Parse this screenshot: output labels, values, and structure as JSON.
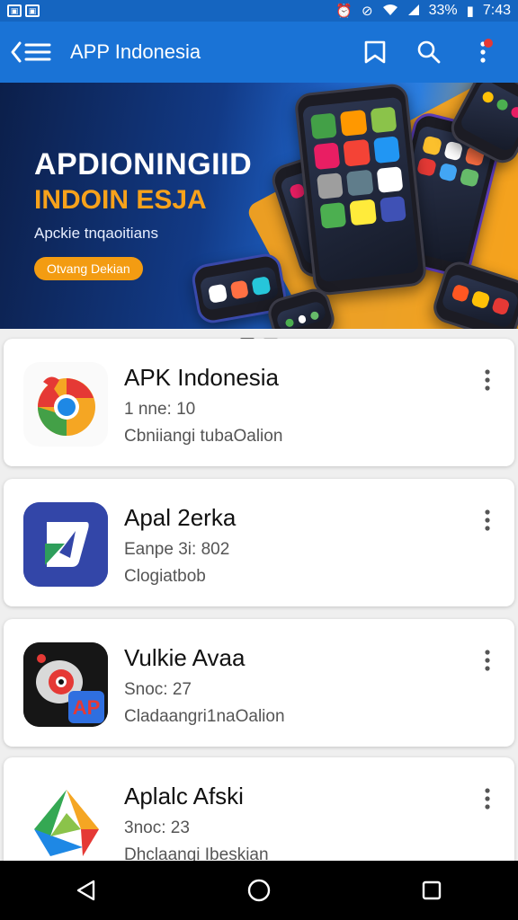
{
  "status_bar": {
    "left_icons": [
      "notification-icon",
      "notification-icon"
    ],
    "right_icons": [
      "alarm-icon",
      "no-sim-icon",
      "wifi-icon",
      "signal-icon"
    ],
    "battery": "33%",
    "time": "7:43"
  },
  "app_bar": {
    "title": "APP Indonesia",
    "icons": [
      "back-menu-icon",
      "bookmark-icon",
      "search-icon",
      "more-vert-icon"
    ]
  },
  "banner": {
    "title": "APDIONINGIID",
    "subtitle": "INDOIN ESJA",
    "tagline": "Apckie tnqaoitians",
    "button_label": "Otvang Dekian"
  },
  "pager": {
    "count": 2,
    "active": 0
  },
  "apps": [
    {
      "name": "APK Indonesia",
      "line1": "1 nne: 10",
      "line2": "Cbniiangi tubaOalion",
      "icon": "chrome-like-icon"
    },
    {
      "name": "Apal  2erka",
      "line1": "Eanpe 3i: 802",
      "line2": "Clogiatbob",
      "icon": "play-arrow-icon"
    },
    {
      "name": "Vulkie Avaa",
      "line1": "Snoc: 27",
      "line2": "Cladaangri1naOalion",
      "icon": "ap-mascot-icon",
      "icon_badge": "AP"
    },
    {
      "name": "Aplalc Afski",
      "line1": "3noc: 23",
      "line2": "Dhclaangi Ibeskian",
      "icon": "drive-like-icon"
    }
  ],
  "colors": {
    "app_bar": "#1a73d6",
    "status_bar": "#1565c0",
    "accent_orange": "#f7a21b"
  }
}
